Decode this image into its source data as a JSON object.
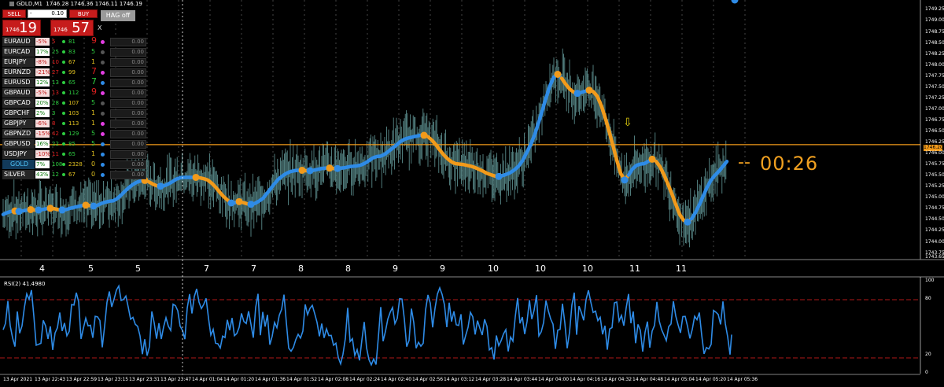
{
  "header": {
    "symbol": "GOLD,M1",
    "ohlc": "1746.28 1746.36 1746.11 1746.19"
  },
  "trade_panel": {
    "sell_label": "SELL",
    "buy_label": "BUY",
    "minus": "-",
    "plus": "+",
    "lot": "0.10",
    "sell_small": "1746",
    "sell_big": "19",
    "buy_small": "1746",
    "buy_big": "57",
    "hag_label": "HAG off",
    "close_label": "X"
  },
  "watchlist": [
    {
      "sym": "EURAUD",
      "pct": "-5%",
      "a": "5",
      "b": "81",
      "n": "9",
      "val": "0.00",
      "pos": false,
      "bc": "#2ecc40",
      "nc": "#e02020",
      "dot": "#e23de2"
    },
    {
      "sym": "EURCAD",
      "pct": "17%",
      "a": "25",
      "b": "83",
      "n": "5",
      "val": "0.00",
      "pos": true,
      "bc": "#2ecc40",
      "nc": "#2ecc40",
      "dot": "#555555"
    },
    {
      "sym": "EURJPY",
      "pct": "-8%",
      "a": "10",
      "b": "67",
      "n": "1",
      "val": "0.00",
      "pos": false,
      "bc": "#e0c020",
      "nc": "#e0c020",
      "dot": "#555555"
    },
    {
      "sym": "EURNZD",
      "pct": "-21%",
      "a": "27",
      "b": "99",
      "n": "7",
      "val": "0.00",
      "pos": false,
      "bc": "#e0c020",
      "nc": "#e02020",
      "dot": "#e23de2"
    },
    {
      "sym": "EURUSD",
      "pct": "12%",
      "a": "13",
      "b": "65",
      "n": "7",
      "val": "0.00",
      "pos": true,
      "bc": "#2ecc40",
      "nc": "#2ecc40",
      "dot": "#2e8be6"
    },
    {
      "sym": "GBPAUD",
      "pct": "-5%",
      "a": "13",
      "b": "112",
      "n": "9",
      "val": "0.00",
      "pos": false,
      "bc": "#2ecc40",
      "nc": "#e02020",
      "dot": "#e23de2"
    },
    {
      "sym": "GBPCAD",
      "pct": "20%",
      "a": "28",
      "b": "107",
      "n": "5",
      "val": "0.00",
      "pos": true,
      "bc": "#e0c020",
      "nc": "#2ecc40",
      "dot": "#555555"
    },
    {
      "sym": "GBPCHF",
      "pct": "2%",
      "a": "3",
      "b": "103",
      "n": "1",
      "val": "0.00",
      "pos": true,
      "bc": "#e0c020",
      "nc": "#e0c020",
      "dot": "#555555"
    },
    {
      "sym": "GBPJPY",
      "pct": "-6%",
      "a": "8",
      "b": "113",
      "n": "1",
      "val": "0.00",
      "pos": false,
      "bc": "#e0c020",
      "nc": "#e0c020",
      "dot": "#e23de2"
    },
    {
      "sym": "GBPNZD",
      "pct": "-15%",
      "a": "42",
      "b": "129",
      "n": "5",
      "val": "0.00",
      "pos": false,
      "bc": "#2ecc40",
      "nc": "#2ecc40",
      "dot": "#e23de2"
    },
    {
      "sym": "GBPUSD",
      "pct": "16%",
      "a": "22",
      "b": "85",
      "n": "5",
      "val": "0.00",
      "pos": true,
      "bc": "#2ecc40",
      "nc": "#2ecc40",
      "dot": "#2e8be6"
    },
    {
      "sym": "USDJPY",
      "pct": "-10%",
      "a": "11",
      "b": "65",
      "n": "1",
      "val": "0.00",
      "pos": false,
      "bc": "#2ecc40",
      "nc": "#e0c020",
      "dot": "#2e8be6"
    },
    {
      "sym": "GOLD",
      "pct": "7%",
      "a": "108",
      "b": "2328",
      "n": "0",
      "val": "0.00",
      "pos": true,
      "bc": "#e0c020",
      "nc": "#e0c020",
      "dot": "#2e8be6",
      "highlight": true
    },
    {
      "sym": "SILVER",
      "pct": "43%",
      "a": "12",
      "b": "67",
      "n": "0",
      "val": "0.00",
      "pos": true,
      "bc": "#e0c020",
      "nc": "#e0c020",
      "dot": "#2e8be6"
    }
  ],
  "countdown": "00:26",
  "countdown_dash": "--",
  "indicator_label": "RSI(2) 41.4980",
  "current_price_label": "1746.20",
  "colors": {
    "up": "#2e8be6",
    "down": "#f29a1a",
    "candle": "#4f7a7a",
    "price_line": "#f29a1a",
    "level": "#b01818",
    "arrow": "#e6d30d"
  },
  "chart_data": [
    {
      "type": "line",
      "title": "GOLD,M1",
      "y_ticks": [
        "1749.25",
        "1749.00",
        "1748.75",
        "1748.50",
        "1748.25",
        "1748.00",
        "1747.75",
        "1747.50",
        "1747.25",
        "1747.00",
        "1746.75",
        "1746.50",
        "1746.25",
        "1746.00",
        "1745.75",
        "1745.50",
        "1745.25",
        "1745.00",
        "1744.75",
        "1744.50",
        "1744.25",
        "1744.00",
        "1743.75",
        "1743.65"
      ],
      "ylim": [
        1743.6,
        1749.4
      ],
      "current_price": 1746.2,
      "x_ticks": [
        "4",
        "5",
        "5",
        "7",
        "7",
        "8",
        "8",
        "9",
        "9",
        "10",
        "10",
        "10",
        "11",
        "11"
      ],
      "arrow_down_x": 10,
      "trend_line": {
        "x": [
          0,
          5,
          10,
          15,
          20,
          25,
          30,
          35,
          40,
          45,
          50,
          55,
          60,
          65,
          70,
          75,
          80,
          85,
          90,
          95,
          100,
          105,
          110,
          115,
          120,
          125,
          130,
          135,
          140,
          145,
          150,
          155,
          160,
          165,
          170,
          175,
          180,
          185,
          190,
          195,
          200,
          205,
          210,
          215,
          220,
          225,
          230,
          235,
          240,
          245,
          250,
          255,
          260,
          265,
          270,
          275,
          280,
          285,
          290,
          295,
          300,
          305,
          310,
          315,
          320,
          325,
          330,
          335,
          340,
          345,
          350,
          355,
          360,
          365,
          370,
          375,
          380,
          385,
          390,
          395,
          400,
          405,
          410,
          415,
          420,
          425,
          430,
          435,
          440,
          445,
          450,
          455,
          460,
          465,
          470,
          475,
          480,
          485,
          490,
          495,
          500,
          505,
          510,
          515,
          520,
          525,
          530,
          535,
          540,
          545,
          550,
          555,
          560,
          565,
          570,
          575,
          580,
          585,
          590,
          595,
          600,
          605,
          610,
          615,
          620,
          625,
          630,
          635,
          640,
          645,
          650,
          655,
          660,
          665,
          670,
          675,
          680,
          685,
          690,
          695,
          700,
          705,
          710,
          715,
          720,
          725,
          730,
          735,
          740,
          745,
          750,
          755,
          760,
          765,
          770,
          775,
          780,
          785,
          790,
          795,
          800,
          805,
          810,
          815,
          820,
          825,
          830,
          835,
          840,
          845,
          850,
          855,
          860,
          865,
          870,
          875,
          880,
          885,
          890,
          895,
          900,
          905,
          910,
          915,
          920,
          925,
          930
        ],
        "y": [
          1744.62,
          1744.66,
          1744.69,
          1744.7,
          1744.69,
          1744.7,
          1744.72,
          1744.73,
          1744.72,
          1744.72,
          1744.73,
          1744.75,
          1744.76,
          1744.75,
          1744.73,
          1744.72,
          1744.73,
          1744.76,
          1744.78,
          1744.8,
          1744.82,
          1744.83,
          1744.82,
          1744.81,
          1744.83,
          1744.87,
          1744.9,
          1744.92,
          1744.93,
          1744.98,
          1745.06,
          1745.15,
          1745.23,
          1745.3,
          1745.35,
          1745.38,
          1745.39,
          1745.36,
          1745.31,
          1745.27,
          1745.26,
          1745.27,
          1745.31,
          1745.36,
          1745.42,
          1745.45,
          1745.46,
          1745.46,
          1745.46,
          1745.46,
          1745.45,
          1745.43,
          1745.4,
          1745.33,
          1745.24,
          1745.13,
          1745.03,
          1744.95,
          1744.88,
          1744.89,
          1744.91,
          1744.89,
          1744.86,
          1744.85,
          1744.87,
          1744.92,
          1744.98,
          1745.09,
          1745.2,
          1745.32,
          1745.42,
          1745.49,
          1745.55,
          1745.59,
          1745.61,
          1745.62,
          1745.62,
          1745.61,
          1745.61,
          1745.62,
          1745.64,
          1745.66,
          1745.67,
          1745.67,
          1745.66,
          1745.66,
          1745.67,
          1745.68,
          1745.7,
          1745.71,
          1745.72,
          1745.74,
          1745.78,
          1745.84,
          1745.9,
          1745.93,
          1745.94,
          1745.98,
          1746.05,
          1746.12,
          1746.19,
          1746.27,
          1746.32,
          1746.35,
          1746.37,
          1746.39,
          1746.41,
          1746.41,
          1746.38,
          1746.3,
          1746.2,
          1746.08,
          1745.97,
          1745.88,
          1745.81,
          1745.77,
          1745.76,
          1745.75,
          1745.73,
          1745.71,
          1745.68,
          1745.64,
          1745.6,
          1745.55,
          1745.52,
          1745.49,
          1745.48,
          1745.5,
          1745.53,
          1745.57,
          1745.63,
          1745.71,
          1745.83,
          1746.0,
          1746.18,
          1746.39,
          1746.66,
          1746.95,
          1747.25,
          1747.53,
          1747.73,
          1747.79,
          1747.7,
          1747.57,
          1747.46,
          1747.39,
          1747.36,
          1747.38,
          1747.41,
          1747.43,
          1747.4,
          1747.3,
          1747.1,
          1746.83,
          1746.52,
          1746.19,
          1745.85,
          1745.55,
          1745.4,
          1745.51,
          1745.65,
          1745.73,
          1745.76,
          1745.77,
          1745.82,
          1745.87,
          1745.82,
          1745.7,
          1745.52,
          1745.31,
          1745.09,
          1744.85,
          1744.62,
          1744.49,
          1744.45,
          1744.52,
          1744.66,
          1744.84,
          1745.04,
          1745.24,
          1745.4,
          1745.51,
          1745.6,
          1745.71,
          1745.82
        ]
      },
      "candles_note": "grey-blue 1-minute candle wicks behind trend line"
    },
    {
      "type": "line",
      "title": "RSI(2) 41.4980",
      "y_ticks": [
        "100",
        "80",
        "20",
        "0"
      ],
      "ylim": [
        0,
        100
      ],
      "levels": [
        80,
        20
      ],
      "x_time_labels": [
        "13 Apr 2021",
        "13 Apr 22:43",
        "13 Apr 22:59",
        "13 Apr 23:15",
        "13 Apr 23:31",
        "13 Apr 23:47",
        "14 Apr 01:04",
        "14 Apr 01:20",
        "14 Apr 01:36",
        "14 Apr 01:52",
        "14 Apr 02:08",
        "14 Apr 02:24",
        "14 Apr 02:40",
        "14 Apr 02:56",
        "14 Apr 03:12",
        "14 Apr 03:28",
        "14 Apr 03:44",
        "14 Apr 04:00",
        "14 Apr 04:16",
        "14 Apr 04:32",
        "14 Apr 04:48",
        "14 Apr 05:04",
        "14 Apr 05:20",
        "14 Apr 05:36"
      ],
      "last_value": 41.498
    }
  ]
}
